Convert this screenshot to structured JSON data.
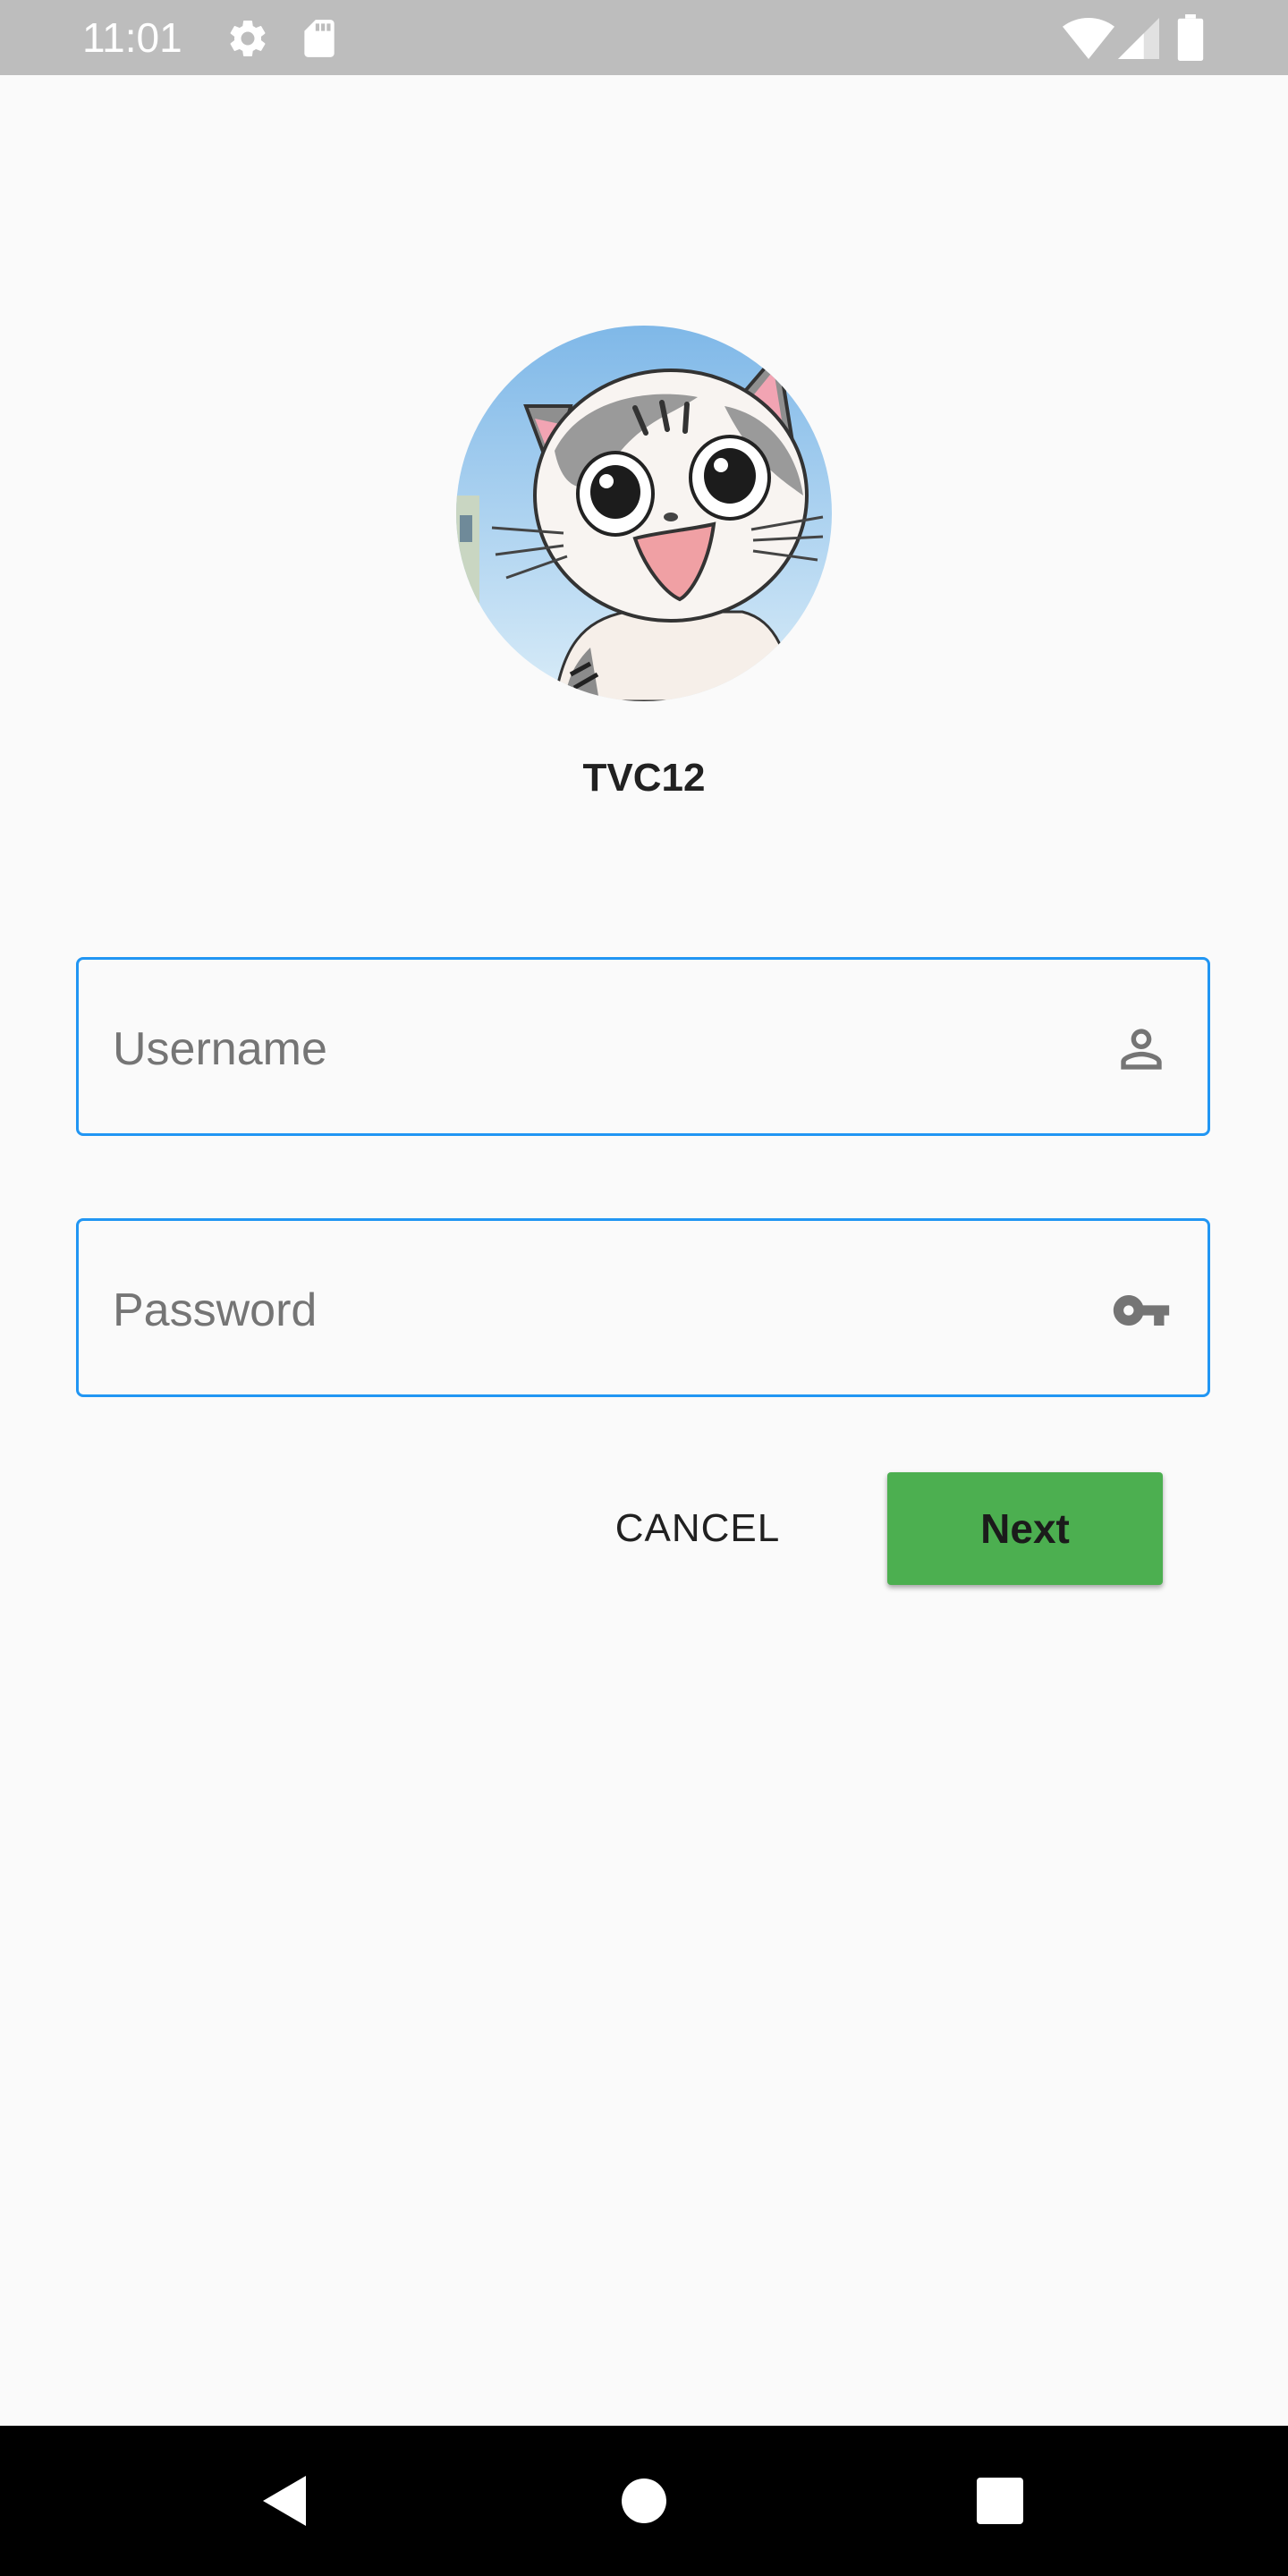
{
  "status_bar": {
    "time": "11:01",
    "icons": [
      "gear-icon",
      "sd-card-icon",
      "wifi-icon",
      "cell-signal-icon",
      "battery-icon"
    ],
    "color": "#bdbdbd"
  },
  "profile": {
    "avatar": "cat-avatar-image",
    "name": "TVC12"
  },
  "form": {
    "username": {
      "placeholder": "Username",
      "value": "",
      "icon": "person-icon"
    },
    "password": {
      "placeholder": "Password",
      "value": "",
      "icon": "key-icon"
    },
    "field_border_color": "#2196f3"
  },
  "actions": {
    "cancel_label": "CANCEL",
    "next_label": "Next",
    "next_color": "#4caf50"
  },
  "nav_bar": {
    "icons": [
      "back-icon",
      "home-icon",
      "recents-icon"
    ]
  }
}
